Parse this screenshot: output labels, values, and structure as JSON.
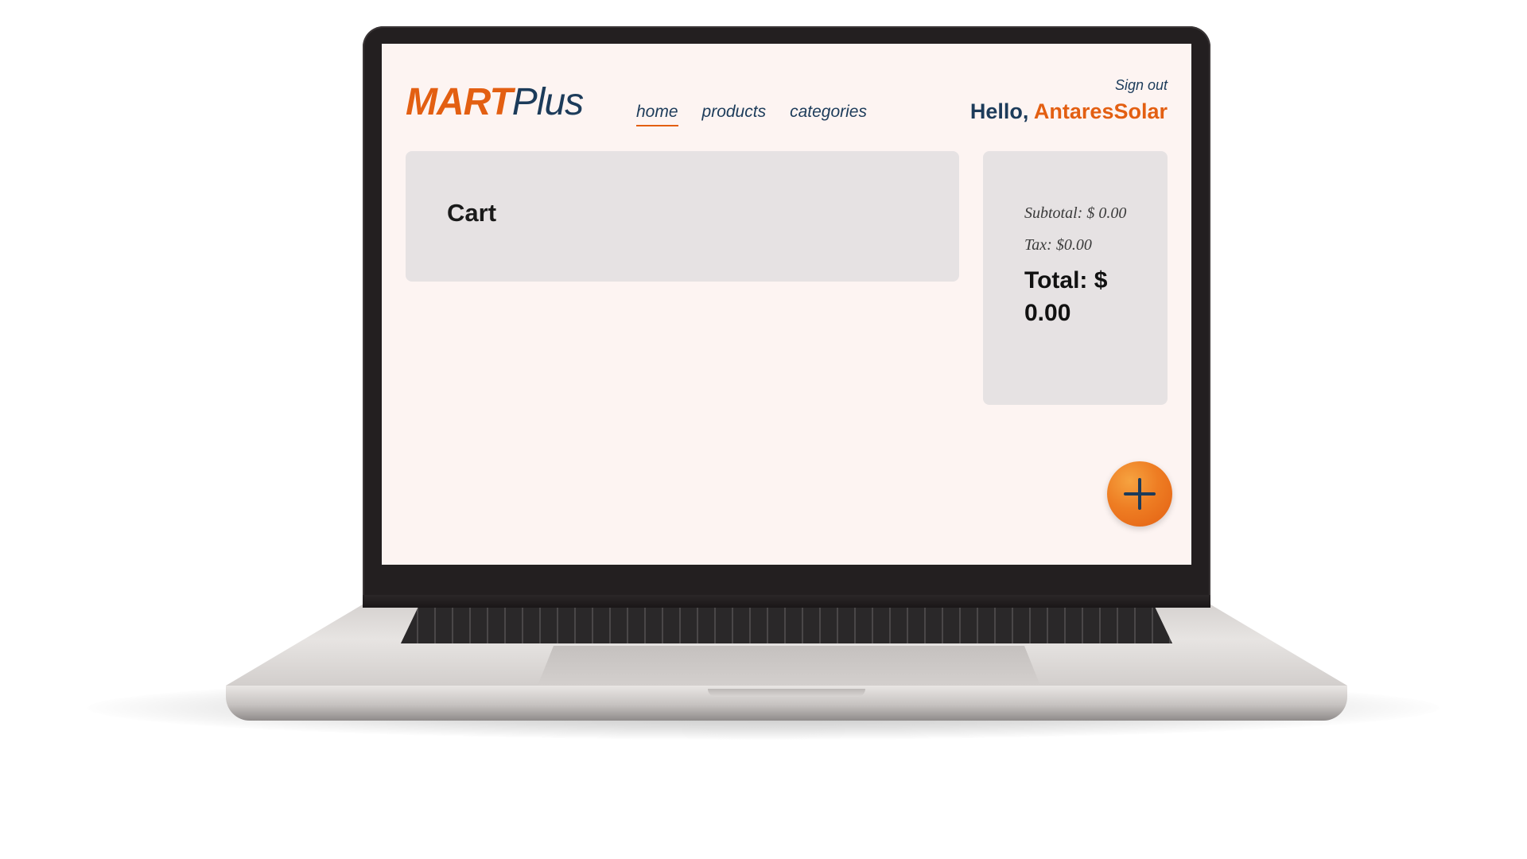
{
  "app": {
    "logo_part1": "MART",
    "logo_part2": "Plus"
  },
  "nav": {
    "items": [
      {
        "label": "home",
        "active": true
      },
      {
        "label": "products",
        "active": false
      },
      {
        "label": "categories",
        "active": false
      }
    ]
  },
  "header": {
    "signout_label": "Sign out",
    "greeting": "Hello, ",
    "username": "AntaresSolar"
  },
  "cart": {
    "title": "Cart"
  },
  "summary": {
    "subtotal": "Subtotal: $ 0.00",
    "tax": "Tax: $0.00",
    "total": "Total: $ 0.00"
  },
  "fab": {
    "icon": "plus-icon"
  },
  "colors": {
    "brand_orange": "#e35f12",
    "brand_navy": "#1c3b5a",
    "page_background": "#fdf4f2",
    "panel_background": "#e6e2e3"
  }
}
